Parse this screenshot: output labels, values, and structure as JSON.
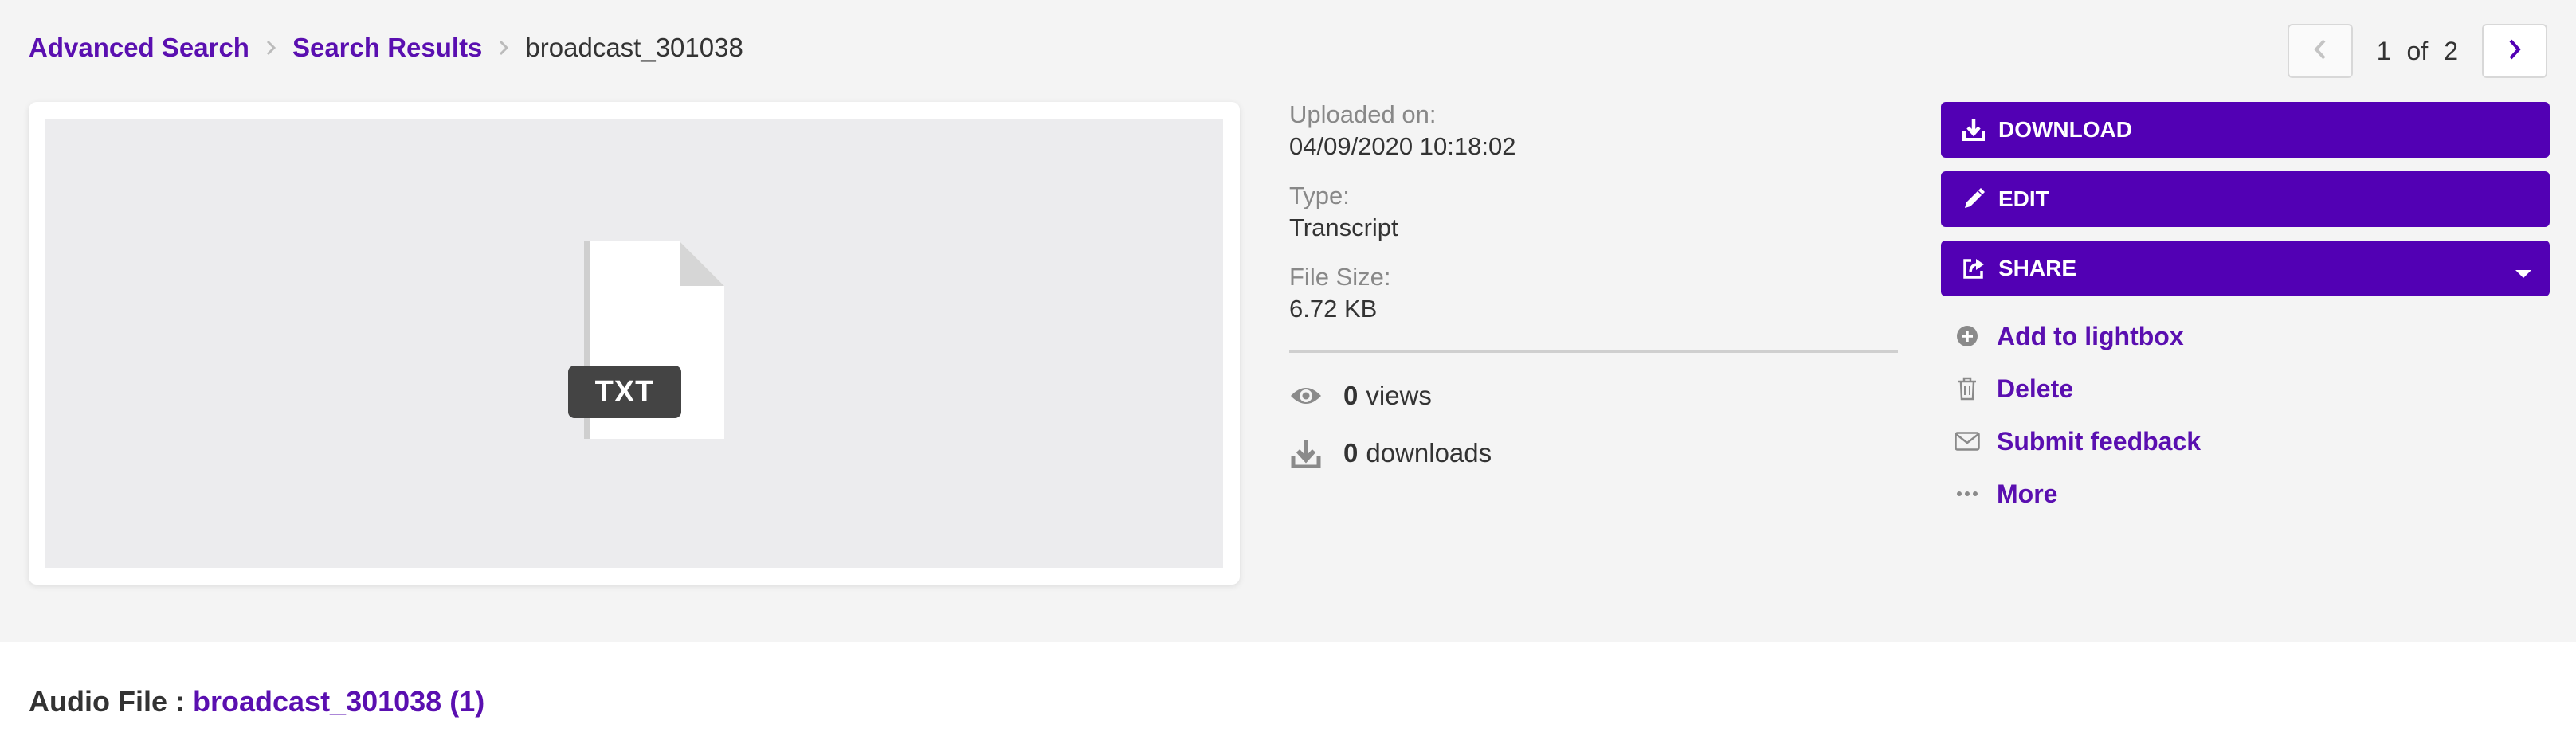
{
  "breadcrumb": {
    "items": [
      {
        "label": "Advanced Search"
      },
      {
        "label": "Search Results"
      }
    ],
    "current": "broadcast_301038"
  },
  "pager": {
    "current": "1",
    "of": "of",
    "total": "2"
  },
  "preview": {
    "file_type_badge": "TXT",
    "icon": "document-icon"
  },
  "meta": {
    "uploaded_label": "Uploaded on:",
    "uploaded_value": "04/09/2020 10:18:02",
    "type_label": "Type:",
    "type_value": "Transcript",
    "size_label": "File Size:",
    "size_value": "6.72 KB"
  },
  "stats": {
    "views_count": "0",
    "views_label": "views",
    "downloads_count": "0",
    "downloads_label": "downloads"
  },
  "actions": {
    "download": "DOWNLOAD",
    "edit": "EDIT",
    "share": "SHARE",
    "add_to_lightbox": "Add to lightbox",
    "delete": "Delete",
    "submit_feedback": "Submit feedback",
    "more": "More"
  },
  "related": {
    "label": "Audio File :",
    "link": "broadcast_301038 (1)"
  },
  "colors": {
    "accent": "#5200b4",
    "link": "#5a0fb0",
    "background": "#f4f4f4"
  }
}
